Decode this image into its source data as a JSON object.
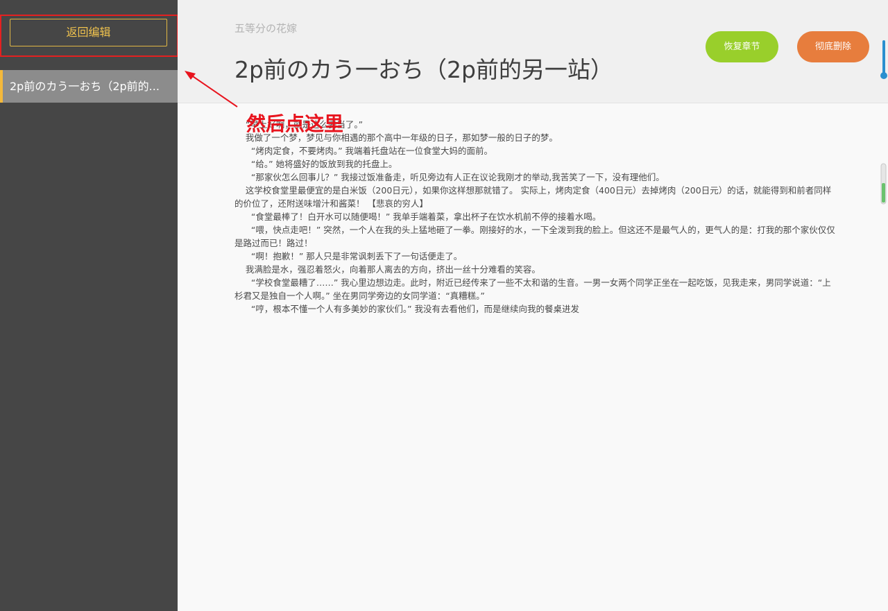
{
  "sidebar": {
    "back_button": "返回编辑",
    "chapter_item": "2p前のカう一おち（2p前的..."
  },
  "header": {
    "book_title": "五等分の花嫁",
    "chapter_title": "2p前のカう一おち（2p前的另一站）",
    "restore_button": "恢复章节",
    "delete_button": "彻底删除"
  },
  "annotation": {
    "text": "然后点这里"
  },
  "content": {
    "paragraphs": [
      "    “早上好啊，就是这么妥当了。”",
      "    我做了一个梦，梦见与你相遇的那个高中一年级的日子，那如梦一般的日子的梦。",
      "      “烤肉定食，不要烤肉。” 我端着托盘站在一位食堂大妈的面前。",
      "      “给。” 她将盛好的饭放到我的托盘上。",
      "      “那家伙怎么回事儿？” 我接过饭准备走，听见旁边有人正在议论我刚才的举动,我苦笑了一下，没有理他们。",
      "    这学校食堂里最便宜的是白米饭（200日元），如果你这样想那就错了。 实际上，烤肉定食（400日元）去掉烤肉（200日元）的话，就能得到和前者同样的价位了，还附送味增汁和酱菜！ 【悲哀的穷人】",
      "      “食堂最棒了！白开水可以随便喝！” 我单手端着菜，拿出杯子在饮水机前不停的接着水喝。",
      "      “喂，快点走吧！” 突然，一个人在我的头上猛地砸了一拳。刚接好的水，一下全泼到我的脸上。但这还不是最气人的，更气人的是：打我的那个家伙仅仅是路过而已！路过！",
      "      “啊！抱歉！” 那人只是非常讽刺丢下了一句话便走了。",
      "    我满脸是水，强忍着怒火，向着那人离去的方向，挤出一丝十分难看的笑容。",
      "      “学校食堂最糟了……” 我心里边想边走。此时，附近已经传来了一些不太和谐的生音。一男一女两个同学正坐在一起吃饭，见我走来，男同学说道：“上杉君又是独自一个人啊。” 坐在男同学旁边的女同学道：“真糟糕。”",
      "      “哼，根本不懂一个人有多美妙的家伙们。” 我没有去看他们，而是继续向我的餐桌进发"
    ]
  },
  "colors": {
    "sidebar_bg": "#464646",
    "accent_yellow": "#f0c34e",
    "restore_green": "#99cf2b",
    "delete_orange": "#e77d3d",
    "annotation_red": "#e8141e"
  }
}
